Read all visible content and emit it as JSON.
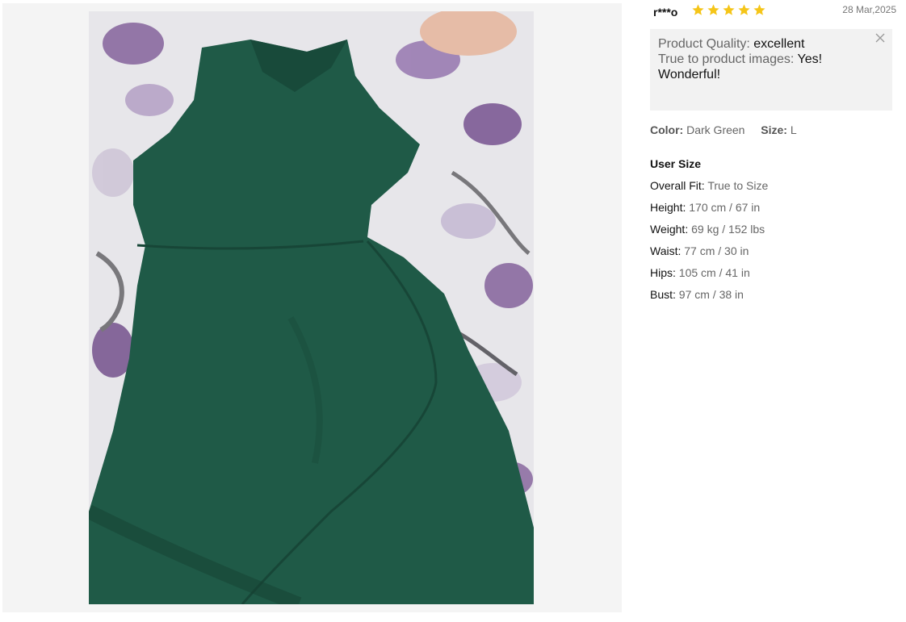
{
  "review": {
    "user": "r***o",
    "rating": 5,
    "date": "28 Mar,2025",
    "star_color": "#f5c518",
    "close_icon": "close-icon",
    "quality": {
      "product_quality_label": "Product Quality:",
      "product_quality_value": "excellent",
      "true_to_images_label": "True to product images:",
      "true_to_images_value": "Yes! Wonderful!"
    },
    "variant": {
      "color_label": "Color:",
      "color_value": "Dark Green",
      "size_label": "Size:",
      "size_value": "L"
    },
    "user_size": {
      "title": "User Size",
      "rows": [
        {
          "label": "Overall Fit:",
          "value": "True to Size"
        },
        {
          "label": "Height:",
          "value": "170 cm / 67 in"
        },
        {
          "label": "Weight:",
          "value": "69 kg / 152 lbs"
        },
        {
          "label": "Waist:",
          "value": "77 cm / 30 in"
        },
        {
          "label": "Hips:",
          "value": "105 cm / 41 in"
        },
        {
          "label": "Bust:",
          "value": "97 cm / 38 in"
        }
      ]
    }
  },
  "photo": {
    "subject": "dark green halter dress on floral bedsheet",
    "dress_color": "#1e5a46"
  }
}
